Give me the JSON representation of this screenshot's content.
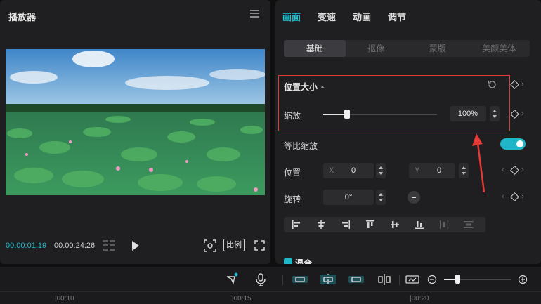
{
  "player": {
    "title": "播放器",
    "current_time": "00:00:01:19",
    "total_time": "00:00:24:26",
    "ratio_label": "比例"
  },
  "props": {
    "tabs": [
      {
        "label": "画面",
        "active": true
      },
      {
        "label": "变速",
        "active": false
      },
      {
        "label": "动画",
        "active": false
      },
      {
        "label": "调节",
        "active": false
      }
    ],
    "subtabs": [
      {
        "label": "基础",
        "active": true
      },
      {
        "label": "抠像",
        "active": false
      },
      {
        "label": "蒙版",
        "active": false
      },
      {
        "label": "美颜美体",
        "active": false
      }
    ],
    "section_title": "位置大小",
    "scale_label": "缩放",
    "scale_value": "100%",
    "scale_fraction": 0.22,
    "uniform_label": "等比缩放",
    "uniform_on": true,
    "position_label": "位置",
    "x_label": "X",
    "x_value": "0",
    "y_label": "Y",
    "y_value": "0",
    "rotate_label": "旋转",
    "rotate_value": "0°",
    "blend_label": "混合"
  },
  "timeline": {
    "ticks": [
      "|00:10",
      "|00:15",
      "|00:20"
    ],
    "zoom_fraction": 0.2
  },
  "colors": {
    "accent": "#1fb7c8",
    "highlight": "#e53935"
  }
}
